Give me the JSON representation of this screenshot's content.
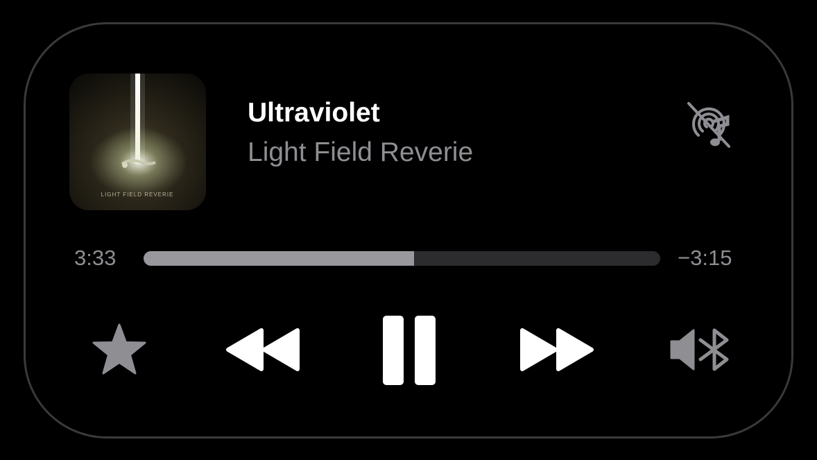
{
  "now_playing": {
    "title": "Ultraviolet",
    "artist": "Light Field Reverie",
    "artwork_text": "LIGHT FIELD REVERIE",
    "artwork_icon": "album-artwork"
  },
  "progress": {
    "elapsed": "3:33",
    "remaining": "−3:15",
    "fraction": 0.523
  },
  "controls": {
    "favorite": "star-icon",
    "previous": "rewind-icon",
    "play_pause": "pause-icon",
    "next": "fast-forward-icon",
    "output": "speaker-bluetooth-icon",
    "airplay_status": "airplay-audio-off-icon"
  },
  "colors": {
    "background": "#000000",
    "title": "#ffffff",
    "secondary_text": "#8e8e93",
    "track": "#2c2c2e",
    "track_fill": "#98989d",
    "controls": "#ffffff",
    "disabled_icon": "#8e8e93"
  }
}
